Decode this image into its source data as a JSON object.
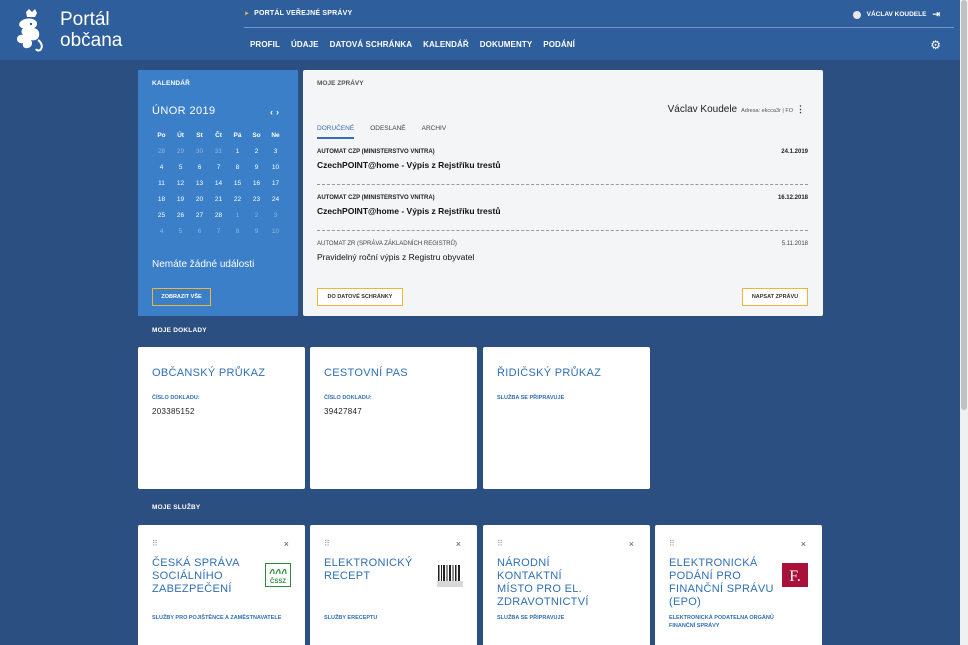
{
  "header": {
    "logo_line1": "Portál",
    "logo_line2": "občana",
    "top_link": "PORTÁL VEŘEJNÉ SPRÁVY",
    "nav": [
      "PROFIL",
      "ÚDAJE",
      "DATOVÁ SCHRÁNKA",
      "KALENDÁŘ",
      "DOKUMENTY",
      "PODÁNÍ"
    ],
    "user_name": "VÁCLAV KOUDELE"
  },
  "calendar": {
    "label": "KALENDÁŘ",
    "month": "ÚNOR 2019",
    "arrows": "‹ ›",
    "day_names": [
      "Po",
      "Út",
      "St",
      "Čt",
      "Pá",
      "So",
      "Ne"
    ],
    "weeks": [
      [
        "28",
        "29",
        "30",
        "31",
        "1",
        "2",
        "3"
      ],
      [
        "4",
        "5",
        "6",
        "7",
        "8",
        "9",
        "10"
      ],
      [
        "11",
        "12",
        "13",
        "14",
        "15",
        "16",
        "17"
      ],
      [
        "18",
        "19",
        "20",
        "21",
        "22",
        "23",
        "24"
      ],
      [
        "25",
        "26",
        "27",
        "28",
        "1",
        "2",
        "3"
      ],
      [
        "4",
        "5",
        "6",
        "7",
        "8",
        "9",
        "10"
      ]
    ],
    "no_events": "Nemáte žádné události",
    "show_all": "ZOBRAZIT VŠE"
  },
  "messages": {
    "label": "MOJE ZPRÁVY",
    "owner": "Václav Koudele",
    "address": "Adresa: ekcca3r | FO",
    "tabs": [
      "DORUČENÉ",
      "ODESLANÉ",
      "ARCHIV"
    ],
    "items": [
      {
        "sender": "AUTOMAT CZP (MINISTERSTVO VNITRA)",
        "date": "24.1.2019",
        "subject": "CzechPOINT@home - Výpis z Rejstříku trestů"
      },
      {
        "sender": "AUTOMAT CZP (MINISTERSTVO VNITRA)",
        "date": "16.12.2018",
        "subject": "CzechPOINT@home - Výpis z Rejstříku trestů"
      },
      {
        "sender": "AUTOMAT ZR (SPRÁVA ZÁKLADNÍCH REGISTRŮ)",
        "date": "5.11.2018",
        "subject": "Pravidelný roční výpis z Registru obyvatel"
      }
    ],
    "btn_inbox": "DO DATOVÉ SCHRÁNKY",
    "btn_write": "NAPSAT ZPRÁVU"
  },
  "documents": {
    "section_title": "MOJE DOKLADY",
    "cards": [
      {
        "title": "OBČANSKÝ PRŮKAZ",
        "label": "ČÍSLO DOKLADU:",
        "value": "203385152"
      },
      {
        "title": "CESTOVNÍ PAS",
        "label": "ČÍSLO DOKLADU:",
        "value": "39427847"
      },
      {
        "title": "ŘIDIČSKÝ PRŮKAZ",
        "label": "SLUŽBA SE PŘIPRAVUJE",
        "value": ""
      }
    ]
  },
  "services": {
    "section_title": "MOJE SLUŽBY",
    "cards": [
      {
        "title": "ČESKÁ SPRÁVA SOCIÁLNÍHO ZABEZPEČENÍ",
        "sub": "SLUŽBY PRO POJIŠTĚNCE A ZAMĚSTNAVATELE",
        "logo": "ČSSZ"
      },
      {
        "title": "ELEKTRONICKÝ RECEPT",
        "sub": "SLUŽBY ERECEPTU",
        "logo": "barcode"
      },
      {
        "title": "NÁRODNÍ KONTAKTNÍ MÍSTO PRO EL. ZDRAVOTNICTVÍ",
        "sub": "SLUŽBA SE PŘIPRAVUJE",
        "logo": ""
      },
      {
        "title": "ELEKTRONICKÁ PODÁNÍ PRO FINANČNÍ SPRÁVU (EPO)",
        "sub": "ELEKTRONICKÁ PODATELNA ORGÁNŮ FINANČNÍ SPRÁVY",
        "logo": "F."
      }
    ]
  },
  "colors": {
    "header": "#2f5e9c",
    "background": "#2b4f80",
    "calendar": "#3b7fc8",
    "accent": "#f0b43a",
    "link": "#2f6fb5",
    "epo_logo": "#a8113a",
    "cssz_logo": "#2e8b3a"
  }
}
